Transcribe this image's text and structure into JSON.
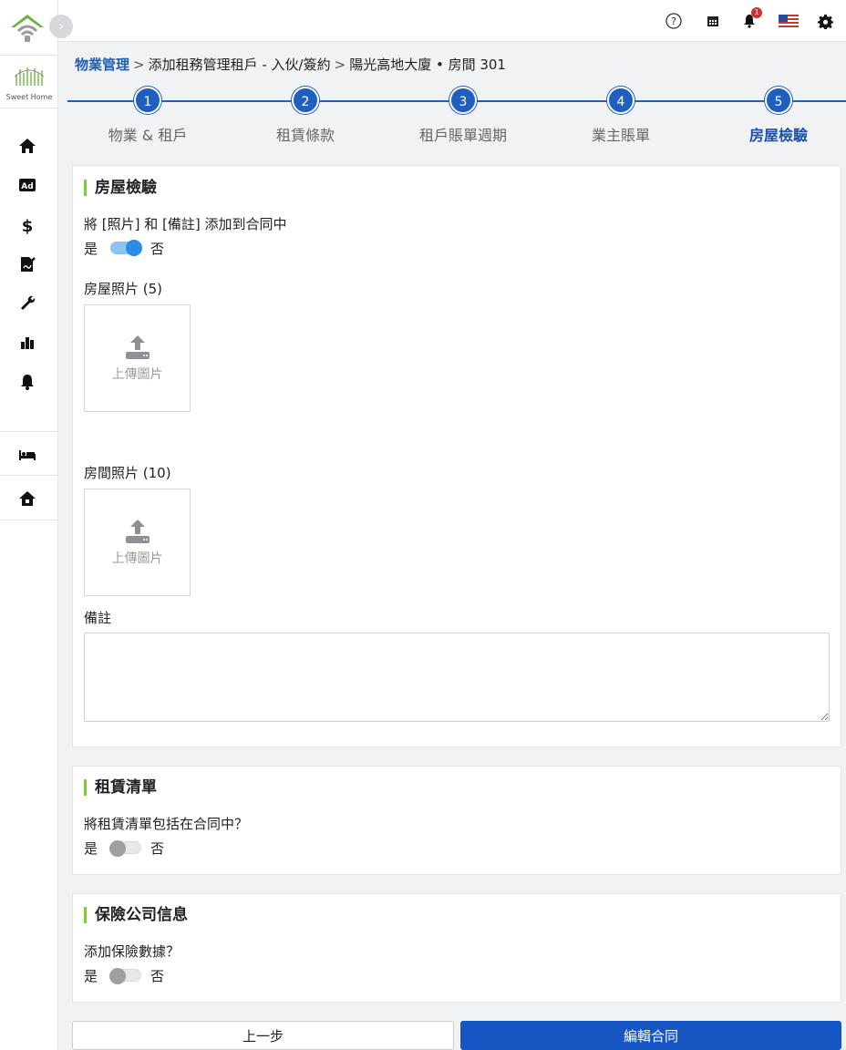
{
  "brand": {
    "caption": "Sweet Home"
  },
  "topbar": {
    "icons": [
      "help-icon",
      "calendar-icon",
      "bell-icon",
      "us-flag-icon",
      "gear-icon"
    ],
    "notification_count": "1"
  },
  "sidebar": {
    "items": [
      "home-icon",
      "ad-icon",
      "dollar-icon",
      "contract-icon",
      "wrench-icon",
      "chart-icon",
      "bell-icon",
      "bed-icon",
      "house-icon"
    ]
  },
  "breadcrumb": {
    "root": "物業管理",
    "separator": ">",
    "step": "添加租務管理租戶 - 入伙/簽約",
    "current": "陽光高地大廈 • 房間 301"
  },
  "stepper": {
    "steps": [
      {
        "number": "1",
        "label": "物業 & 租戶"
      },
      {
        "number": "2",
        "label": "租賃條款"
      },
      {
        "number": "3",
        "label": "租戶賬單週期"
      },
      {
        "number": "4",
        "label": "業主賬單"
      },
      {
        "number": "5",
        "label": "房屋檢驗"
      }
    ],
    "active_step": 5
  },
  "inspection": {
    "title": "房屋檢驗",
    "question": "將 [照片] 和 [備註] 添加到合同中",
    "yes": "是",
    "no": "否",
    "toggle_on": true,
    "house_photos_label": "房屋照片 (5)",
    "room_photos_label": "房間照片 (10)",
    "upload_label": "上傳圖片",
    "notes_label": "備註",
    "notes_value": ""
  },
  "rental_list": {
    "title": "租賃清單",
    "question": "將租賃清單包括在合同中？",
    "yes": "是",
    "no": "否",
    "toggle_on": false
  },
  "insurance": {
    "title": "保險公司信息",
    "question": "添加保險數據？",
    "yes": "是",
    "no": "否",
    "toggle_on": false
  },
  "buttons": {
    "prev": "上一步",
    "edit_contract": "編輯合同"
  },
  "colors": {
    "primary": "#1656c2",
    "step": "#1e5fbf",
    "accent_bar": "#8bc34a",
    "toggle_on": "#2b8de3"
  }
}
